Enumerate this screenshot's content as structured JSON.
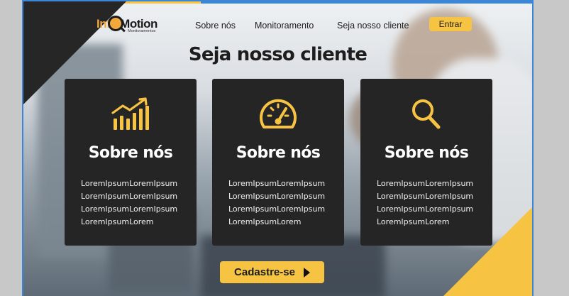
{
  "brand": {
    "name_part1": "Info",
    "name_part2": "Motion",
    "subtitle": "Monitoramentos"
  },
  "nav": {
    "items": [
      "Sobre nós",
      "Monitoramento",
      "Seja nosso cliente"
    ],
    "login_label": "Entrar"
  },
  "hero": {
    "title": "Seja nosso cliente"
  },
  "cards": [
    {
      "icon": "bar-chart-trend-icon",
      "title": "Sobre nós",
      "text": "LoremIpsumLoremIpsumLoremIpsumLoremIpsumLoremIpsumLoremIpsumLoremIpsumLorem"
    },
    {
      "icon": "speedometer-icon",
      "title": "Sobre nós",
      "text": "LoremIpsumLoremIpsumLoremIpsumLoremIpsumLoremIpsumLoremIpsumLoremIpsumLorem"
    },
    {
      "icon": "search-icon",
      "title": "Sobre nós",
      "text": "LoremIpsumLoremIpsumLoremIpsumLoremIpsumLoremIpsumLoremIpsumLoremIpsumLorem"
    }
  ],
  "cta": {
    "label": "Cadastre-se",
    "icon": "play-arrow-icon"
  },
  "colors": {
    "accent": "#f7c342",
    "card_bg": "#252525",
    "frame_border": "#3b86d6"
  }
}
